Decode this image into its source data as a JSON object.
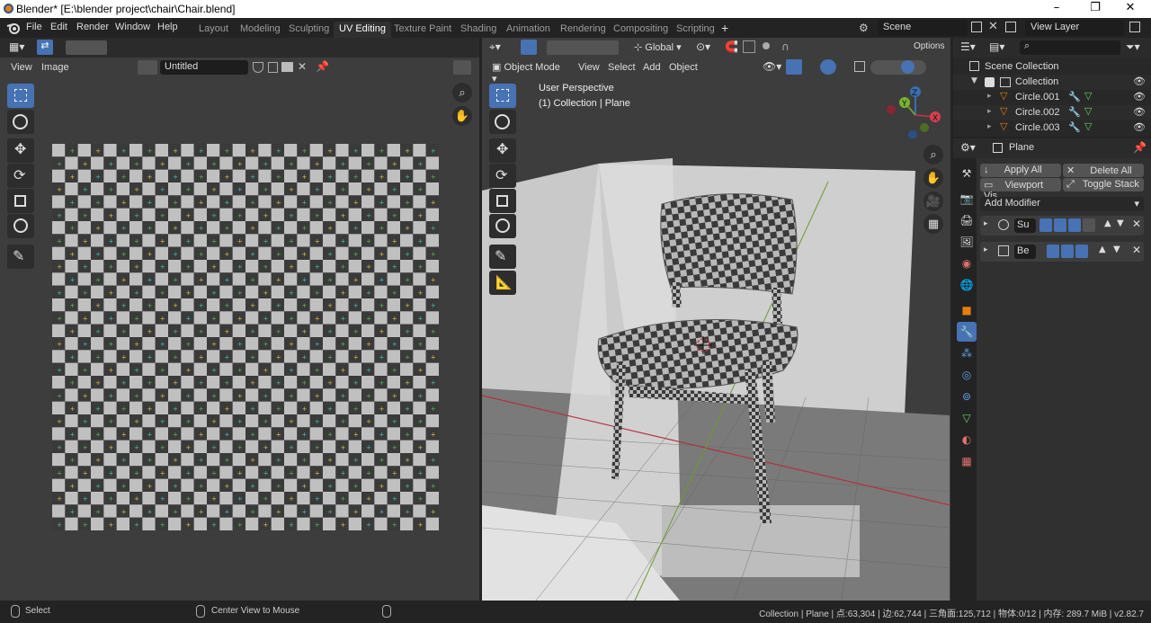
{
  "window": {
    "title": "Blender* [E:\\blender project\\chair\\Chair.blend]",
    "minimize": "–",
    "maximize": "❐",
    "close": "✕"
  },
  "menu": [
    "File",
    "Edit",
    "Render",
    "Window",
    "Help"
  ],
  "workspaces": [
    "Layout",
    "Modeling",
    "Sculpting",
    "UV Editing",
    "Texture Paint",
    "Shading",
    "Animation",
    "Rendering",
    "Compositing",
    "Scripting"
  ],
  "workspace_add": "+",
  "scene": {
    "name": "Scene",
    "view_layer": "View Layer"
  },
  "uv_editor": {
    "menu_view": "View",
    "menu_image": "Image",
    "image_name": "Untitled",
    "colors": {
      "light": "#c0c0c0",
      "dark": "#3a3a3a"
    }
  },
  "viewport": {
    "mode": "Object Mode",
    "menus": [
      "View",
      "Select",
      "Add",
      "Object"
    ],
    "orientation": "Global",
    "options": "Options",
    "overlay_title": "User Perspective",
    "overlay_subtitle": "(1) Collection | Plane",
    "gizmo": {
      "x": "X",
      "y": "Y",
      "z": "Z"
    }
  },
  "outliner": {
    "root": "Scene Collection",
    "collection": "Collection",
    "items": [
      "Circle.001",
      "Circle.002",
      "Circle.003"
    ]
  },
  "properties": {
    "object": "Plane",
    "apply_all": "Apply All",
    "delete_all": "Delete All",
    "viewport_vis": "Viewport Vis",
    "toggle_stack": "Toggle Stack",
    "add_modifier": "Add Modifier",
    "modifiers": [
      {
        "name": "Su"
      },
      {
        "name": "Be"
      }
    ]
  },
  "status": {
    "left": "Select",
    "middle": "Center View to Mouse",
    "right": "Collection | Plane | 点:63,304 | 边:62,744 | 三角面:125,712 | 物体:0/12 | 内存: 289.7 MiB | v2.82.7"
  }
}
